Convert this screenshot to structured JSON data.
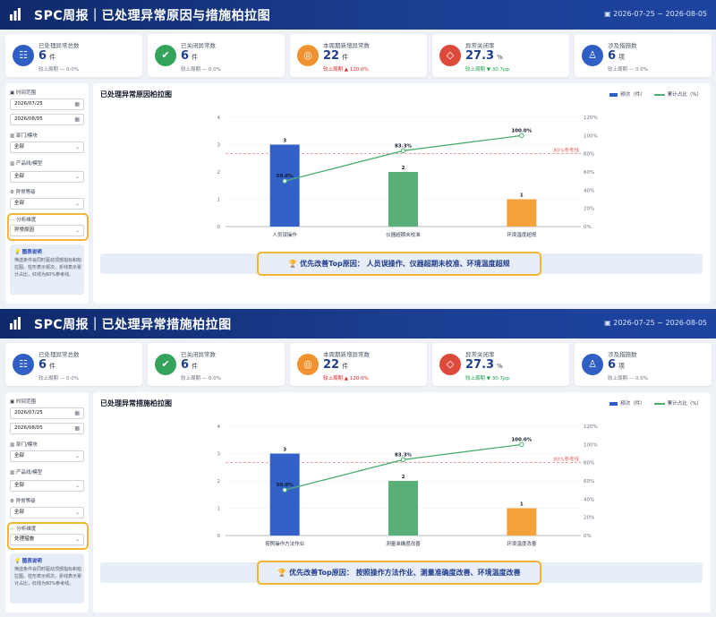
{
  "colors": {
    "bar": [
      "#3361c8",
      "#5aae78",
      "#f3a23c"
    ],
    "line": "#4caf6e",
    "ref": "#e06666",
    "highlight": "#f2b534",
    "header": "#1c3f94"
  },
  "panels": [
    {
      "header": {
        "title": "SPC周报｜已处理异常原因与措施柏拉图",
        "date_range": "▣ 2026-07-25 ~ 2026-08-05"
      },
      "kpis": [
        {
          "icon": "list-icon",
          "color": "#2f5fc4",
          "glyph": "☷",
          "label": "已处理异常总数",
          "value": "6",
          "unit": "件",
          "sub": "较上周期 — 0.0%",
          "trend": "flat"
        },
        {
          "icon": "check-icon",
          "color": "#34a35c",
          "glyph": "✔",
          "label": "已关闭异常数",
          "value": "6",
          "unit": "件",
          "sub": "较上周期 — 0.0%",
          "trend": "flat"
        },
        {
          "icon": "target-icon",
          "color": "#f0922f",
          "glyph": "◎",
          "label": "本周期新增异常数",
          "value": "22",
          "unit": "件",
          "sub": "较上周期 ▲ 120.0%",
          "trend": "up"
        },
        {
          "icon": "diamond-warning-icon",
          "color": "#dc4a3c",
          "glyph": "◇",
          "label": "异常关闭率",
          "value": "27.3",
          "unit": "%",
          "sub": "较上周期 ▼ 30.7pp",
          "trend": "down"
        },
        {
          "icon": "flask-icon",
          "color": "#2f5fc4",
          "glyph": "♙",
          "label": "涉及措施数",
          "value": "6",
          "unit": "项",
          "sub": "较上周期 — 0.0%",
          "trend": "flat"
        }
      ],
      "filters": {
        "time_label": "▣ 时间范围",
        "date_from": "2026/07/25",
        "date_to": "2026/08/05",
        "dept_label": "▥ 部门/模块",
        "dept_value": "全部",
        "line_label": "▥ 产品线/模型",
        "line_value": "全部",
        "level_label": "⚙ 异常等级",
        "level_value": "全部",
        "dim_label": "⋯ 分析维度",
        "dim_value": "异常原因"
      },
      "note": {
        "title": "💡 图表说明",
        "body": "筛选条件会同时驱动顶部指标和柏拉图。柱形表示频次，折线表示累计占比，红线为80%参考线。"
      },
      "chart_title": "已处理异常原因柏拉图",
      "legend": {
        "bar": "频次（件）",
        "line": "累计占比（%）"
      },
      "tip": "🏆 优先改善Top原因： 人员误操作、仪器超期未校准、环境温度超规",
      "chart_data": {
        "type": "bar",
        "categories": [
          "人员误操作",
          "仪器超期未校准",
          "环境温度超规"
        ],
        "values": [
          3,
          2,
          1
        ],
        "cumulative": [
          50.0,
          83.3,
          100.0
        ],
        "ylim": [
          0,
          4
        ],
        "y2lim": [
          0,
          120
        ],
        "ref_line": 80,
        "ref_label": "80%参考线"
      }
    },
    {
      "header": {
        "title": "SPC周报｜已处理异常措施柏拉图",
        "date_range": "▣ 2026-07-25 ~ 2026-08-05"
      },
      "kpis": [
        {
          "icon": "list-icon",
          "color": "#2f5fc4",
          "glyph": "☷",
          "label": "已处理异常总数",
          "value": "6",
          "unit": "件",
          "sub": "较上周期 — 0.0%",
          "trend": "flat"
        },
        {
          "icon": "check-icon",
          "color": "#34a35c",
          "glyph": "✔",
          "label": "已关闭异常数",
          "value": "6",
          "unit": "件",
          "sub": "较上周期 — 0.0%",
          "trend": "flat"
        },
        {
          "icon": "target-icon",
          "color": "#f0922f",
          "glyph": "◎",
          "label": "本周期新增异常数",
          "value": "22",
          "unit": "件",
          "sub": "较上周期 ▲ 120.0%",
          "trend": "up"
        },
        {
          "icon": "diamond-warning-icon",
          "color": "#dc4a3c",
          "glyph": "◇",
          "label": "异常关闭率",
          "value": "27.3",
          "unit": "%",
          "sub": "较上周期 ▼ 30.7pp",
          "trend": "down"
        },
        {
          "icon": "flask-icon",
          "color": "#2f5fc4",
          "glyph": "♙",
          "label": "涉及措施数",
          "value": "6",
          "unit": "项",
          "sub": "较上周期 — 0.0%",
          "trend": "flat"
        }
      ],
      "filters": {
        "time_label": "▣ 时间范围",
        "date_from": "2026/07/25",
        "date_to": "2026/08/05",
        "dept_label": "▥ 部门/模块",
        "dept_value": "全部",
        "line_label": "▥ 产品线/模型",
        "line_value": "全部",
        "level_label": "⚙ 异常等级",
        "level_value": "全部",
        "dim_label": "⋯ 分析维度",
        "dim_value": "处理措施"
      },
      "note": {
        "title": "💡 图表说明",
        "body": "筛选条件会同时驱动顶部指标和柏拉图。柱形表示频次，折线表示累计占比，红线为80%参考线。"
      },
      "chart_title": "已处理异常措施柏拉图",
      "legend": {
        "bar": "频次（件）",
        "line": "累计占比（%）"
      },
      "tip": "🏆 优先改善Top原因： 按照操作方法作业、测量准确度改善、环境温度改善",
      "chart_data": {
        "type": "bar",
        "categories": [
          "按照操作方法作业",
          "测量准确度改善",
          "环境温度改善"
        ],
        "values": [
          3,
          2,
          1
        ],
        "cumulative": [
          50.0,
          83.3,
          100.0
        ],
        "ylim": [
          0,
          4
        ],
        "y2lim": [
          0,
          120
        ],
        "ref_line": 80,
        "ref_label": "80%参考线"
      }
    }
  ]
}
